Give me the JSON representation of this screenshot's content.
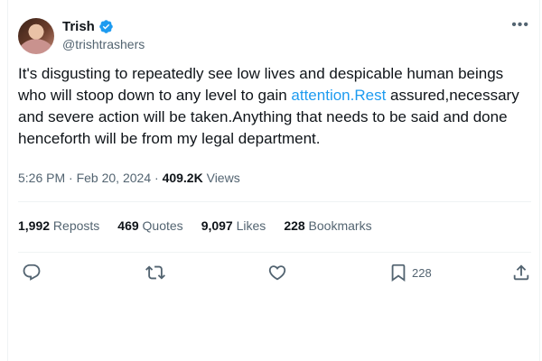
{
  "author": {
    "name": "Trish",
    "handle": "@trishtrashers"
  },
  "tweet": {
    "text_before": "It's disgusting to repeatedly see low lives and despicable human beings who will stoop down to any level to gain ",
    "link_text": "attention.Rest",
    "text_after": " assured,necessary and severe action will be taken.Anything that needs to be said and done henceforth will be from my legal department."
  },
  "meta": {
    "time": "5:26 PM",
    "separator1": " · ",
    "date": "Feb 20, 2024",
    "separator2": " · ",
    "views_count": "409.2K",
    "views_label": " Views"
  },
  "stats": {
    "reposts_count": "1,992",
    "reposts_label": " Reposts",
    "quotes_count": "469",
    "quotes_label": " Quotes",
    "likes_count": "9,097",
    "likes_label": " Likes",
    "bookmarks_count": "228",
    "bookmarks_label": " Bookmarks"
  },
  "actions": {
    "bookmark_count": "228"
  },
  "icons": [
    "verified-badge-icon",
    "more-icon",
    "reply-icon",
    "repost-icon",
    "like-icon",
    "bookmark-icon",
    "share-icon"
  ],
  "colors": {
    "link": "#1d9bf0",
    "text": "#0f1419",
    "secondary": "#536471",
    "divider": "#eff3f4"
  }
}
